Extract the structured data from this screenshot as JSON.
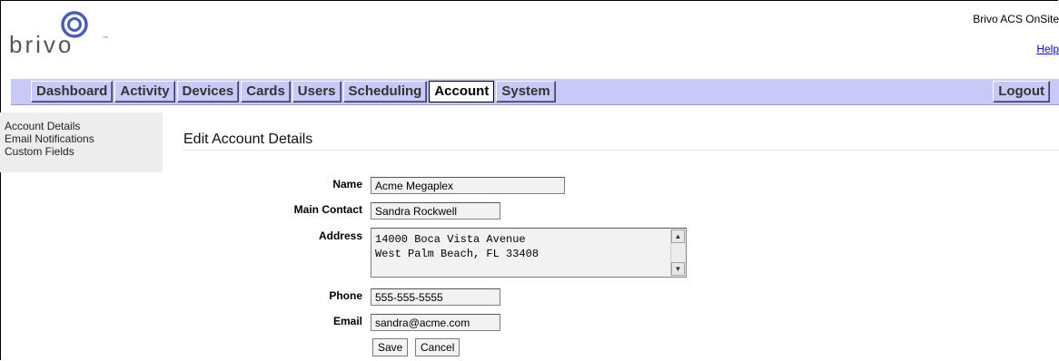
{
  "header": {
    "logo_text": "brivo",
    "app_name": "Brivo ACS OnSite",
    "help_label": "Help"
  },
  "nav": {
    "tabs": [
      {
        "label": "Dashboard"
      },
      {
        "label": "Activity"
      },
      {
        "label": "Devices"
      },
      {
        "label": "Cards"
      },
      {
        "label": "Users"
      },
      {
        "label": "Scheduling"
      },
      {
        "label": "Account",
        "active": true
      },
      {
        "label": "System"
      }
    ],
    "logout_label": "Logout"
  },
  "sidebar": {
    "items": [
      {
        "label": "Account Details"
      },
      {
        "label": "Email Notifications"
      },
      {
        "label": "Custom Fields"
      }
    ]
  },
  "main": {
    "title": "Edit Account Details",
    "form": {
      "name": {
        "label": "Name",
        "value": "Acme Megaplex"
      },
      "main_contact": {
        "label": "Main Contact",
        "value": "Sandra Rockwell"
      },
      "address": {
        "label": "Address",
        "value": "14000 Boca Vista Avenue\nWest Palm Beach, FL 33408"
      },
      "phone": {
        "label": "Phone",
        "value": "555-555-5555"
      },
      "email": {
        "label": "Email",
        "value": "sandra@acme.com"
      },
      "save_label": "Save",
      "cancel_label": "Cancel"
    }
  },
  "colors": {
    "nav_background": "#c8caf6",
    "logo_blue": "#4a5cb8",
    "sidebar_background": "#ededed"
  }
}
